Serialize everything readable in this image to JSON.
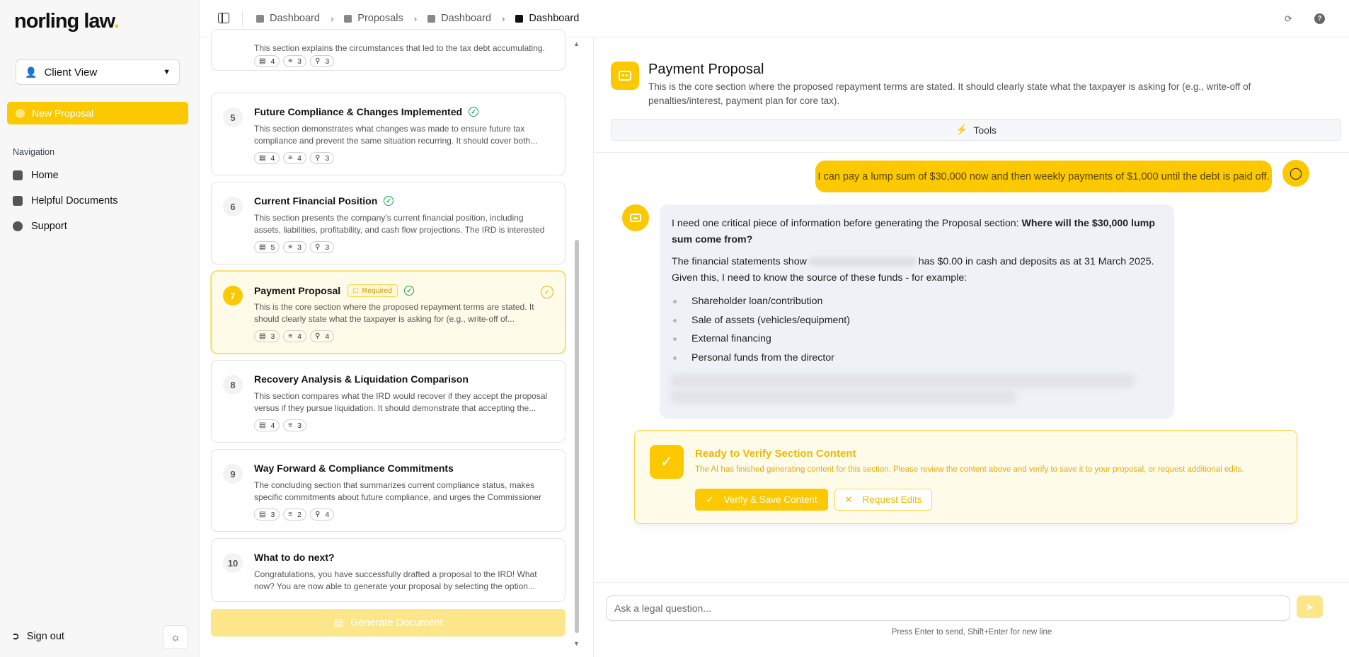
{
  "brand": {
    "logo_text": "norling law",
    "logo_dot": "."
  },
  "sidebar": {
    "view_select": "Client View",
    "new_proposal": "New Proposal",
    "nav_heading": "Navigation",
    "items": [
      {
        "label": "Home"
      },
      {
        "label": "Helpful Documents"
      },
      {
        "label": "Support"
      }
    ],
    "sign_out": "Sign out"
  },
  "breadcrumbs": [
    "Dashboard",
    "Proposals",
    "Dashboard",
    "Dashboard"
  ],
  "sections": [
    {
      "number": "",
      "title": "",
      "desc": "This section explains the circumstances that led to the tax debt accumulating.",
      "chips": [
        "4",
        "3",
        "3"
      ]
    },
    {
      "number": "5",
      "title": "Future Compliance & Changes Implemented",
      "desc": "This section demonstrates what changes was made to ensure future tax compliance and prevent the same situation recurring. It should cover both...",
      "chips": [
        "4",
        "4",
        "3"
      ]
    },
    {
      "number": "6",
      "title": "Current Financial Position",
      "desc": "This section presents the company's current financial position, including assets, liabilities, profitability, and cash flow projections. The IRD is interested in...",
      "chips": [
        "5",
        "3",
        "3"
      ]
    },
    {
      "number": "7",
      "title": "Payment Proposal",
      "badge": "Required",
      "desc": "This is the core section where the proposed repayment terms are stated. It should clearly state what the taxpayer is asking for (e.g., write-off of...",
      "chips": [
        "3",
        "4",
        "4"
      ]
    },
    {
      "number": "8",
      "title": "Recovery Analysis & Liquidation Comparison",
      "desc": "This section compares what the IRD would recover if they accept the proposal versus if they pursue liquidation. It should demonstrate that accepting the...",
      "chips": [
        "4",
        "3"
      ]
    },
    {
      "number": "9",
      "title": "Way Forward & Compliance Commitments",
      "desc": "The concluding section that summarizes current compliance status, makes specific commitments about future compliance, and urges the Commissioner t...",
      "chips": [
        "3",
        "2",
        "4"
      ]
    },
    {
      "number": "10",
      "title": "What to do next?",
      "desc": "Congratulations, you have successfully drafted a proposal to the IRD! What now? You are now able to generate your proposal by selecting the option..."
    }
  ],
  "generate_button": "Generate Document",
  "chat": {
    "title": "Payment Proposal",
    "description": "This is the core section where the proposed repayment terms are stated. It should clearly state what the taxpayer is asking for (e.g., write-off of penalties/interest, payment plan for core tax).",
    "tools_label": "Tools",
    "user_message": "I can pay a lump sum of $30,000 now and then weekly payments of $1,000 until the debt is paid off.",
    "ai_intro": "I need one critical piece of information before generating the Proposal section: ",
    "ai_intro_bold_1": "Where will the $30,000 lump",
    "ai_intro_bold_2": "sum come from?",
    "ai_line2_a": "The financial statements show ",
    "ai_line2_b": " has $0.00 in cash and deposits as at 31 March 2025.",
    "ai_line3": "Given this, I need to know the source of these funds - for example:",
    "ai_options": [
      "Shareholder loan/contribution",
      "Sale of assets (vehicles/equipment)",
      "External financing",
      "Personal funds from the director"
    ]
  },
  "verify": {
    "title": "Ready to Verify Section Content",
    "description": "The AI has finished generating content for this section. Please review the content above and verify to save it to your proposal, or request additional edits.",
    "verify_button": "Verify & Save Content",
    "edit_button": "Request Edits"
  },
  "input": {
    "placeholder": "Ask a legal question...",
    "hint": "Press Enter to send, Shift+Enter for new line"
  }
}
